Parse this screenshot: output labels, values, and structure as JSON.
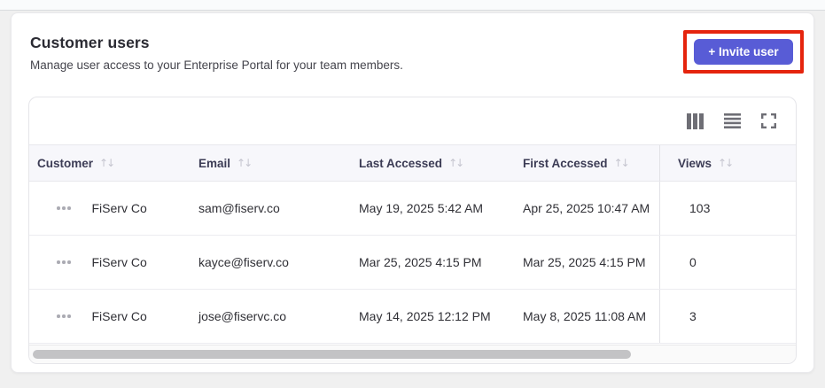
{
  "header": {
    "title": "Customer users",
    "subtitle": "Manage user access to your Enterprise Portal for your team members.",
    "invite_button_label": "+ Invite user"
  },
  "toolbar": {
    "icons": [
      "columns-icon",
      "density-icon",
      "fullscreen-icon"
    ]
  },
  "table": {
    "sort_icon": "↑↓",
    "columns": [
      {
        "key": "customer",
        "label": "Customer"
      },
      {
        "key": "email",
        "label": "Email"
      },
      {
        "key": "last_accessed",
        "label": "Last Accessed"
      },
      {
        "key": "first_accessed",
        "label": "First Accessed"
      },
      {
        "key": "views",
        "label": "Views"
      }
    ],
    "rows": [
      {
        "customer": "FiServ Co",
        "email": "sam@fiserv.co",
        "last_accessed": "May 19, 2025 5:42 AM",
        "first_accessed": "Apr 25, 2025 10:47 AM",
        "views": "103"
      },
      {
        "customer": "FiServ Co",
        "email": "kayce@fiserv.co",
        "last_accessed": "Mar 25, 2025 4:15 PM",
        "first_accessed": "Mar 25, 2025 4:15 PM",
        "views": "0"
      },
      {
        "customer": "FiServ Co",
        "email": "jose@fiservc.co",
        "last_accessed": "May 14, 2025 12:12 PM",
        "first_accessed": "May 8, 2025 11:08 AM",
        "views": "3"
      }
    ]
  },
  "scrollbar": {
    "thumb_percent": 78
  },
  "colors": {
    "accent": "#585cd6",
    "annotation_red": "#e5240d",
    "header_row_bg": "#f7f7fb",
    "page_bg": "#f0f0f0"
  }
}
